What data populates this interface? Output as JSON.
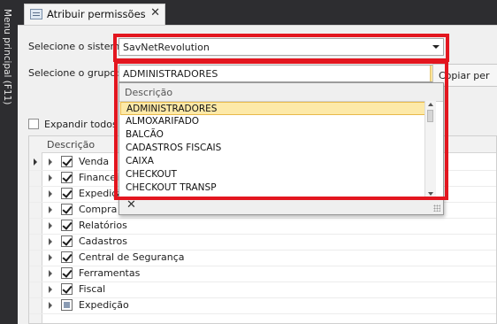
{
  "sidebar": {
    "label": "Menu principal (F11)"
  },
  "tab": {
    "title": "Atribuir permissões",
    "close": "✕"
  },
  "form": {
    "system_label": "Selecione o sistema:",
    "system_value": "SavNetRevolution",
    "group_label": "Selecione o grupo:",
    "group_value": "ADMINISTRADORES",
    "copy_label": "Copiar per",
    "expand_label": "Expandir todos"
  },
  "dropdown": {
    "header": "Descrição",
    "options": [
      {
        "label": "ADMINISTRADORES",
        "selected": true
      },
      {
        "label": "ALMOXARIFADO"
      },
      {
        "label": "BALCÃO"
      },
      {
        "label": "CADASTROS FISCAIS"
      },
      {
        "label": "CAIXA"
      },
      {
        "label": "CHECKOUT"
      },
      {
        "label": "CHECKOUT TRANSP"
      }
    ],
    "clear": "✕"
  },
  "tree": {
    "header": "Descrição",
    "rows": [
      {
        "label": "Venda",
        "state": "checked"
      },
      {
        "label": "Financeiro",
        "state": "checked"
      },
      {
        "label": "Expedição",
        "state": "checked"
      },
      {
        "label": "Compra",
        "state": "checked"
      },
      {
        "label": "Relatórios",
        "state": "checked"
      },
      {
        "label": "Cadastros",
        "state": "checked"
      },
      {
        "label": "Central de Segurança",
        "state": "checked"
      },
      {
        "label": "Ferramentas",
        "state": "checked"
      },
      {
        "label": "Fiscal",
        "state": "checked"
      },
      {
        "label": "Expedição",
        "state": "partial"
      }
    ]
  },
  "colors": {
    "highlight": "#e3161f",
    "selection": "#fde9a8",
    "accent": "#fbe39b"
  }
}
